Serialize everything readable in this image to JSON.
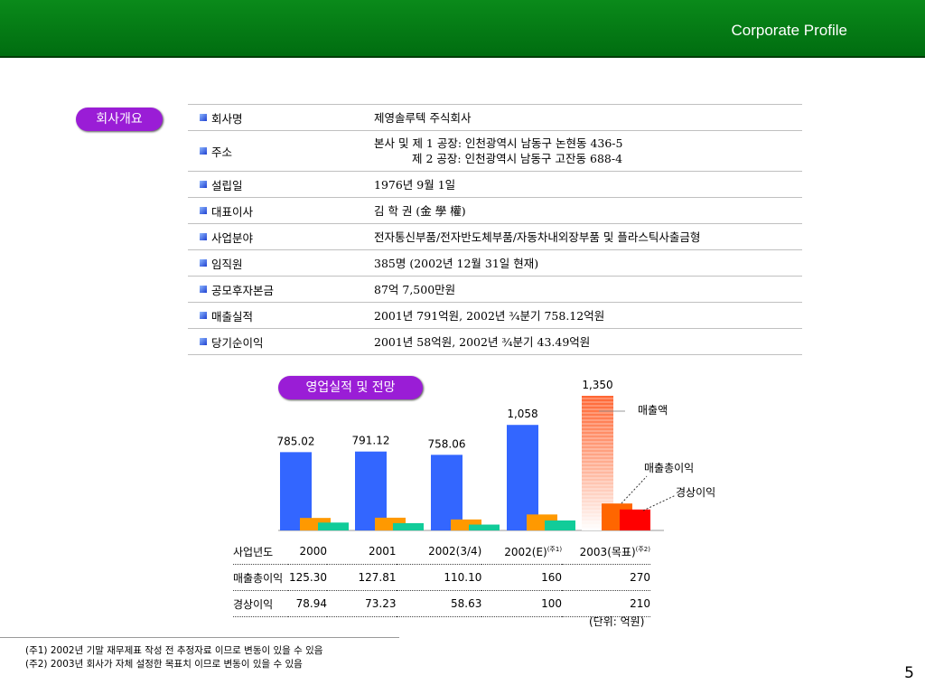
{
  "header": {
    "title": "Corporate Profile"
  },
  "section_profile": {
    "label": "회사개요"
  },
  "section_perf": {
    "label": "영업실적 및 전망"
  },
  "profile": [
    {
      "label": "회사명",
      "lines": [
        "제영솔루텍 주식회사"
      ]
    },
    {
      "label": "주소",
      "lines": [
        "본사 및 제 1 공장:   인천광역시 남동구 논현동 436-5",
        "제 2 공장:   인천광역시 남동구 고잔동 688-4"
      ]
    },
    {
      "label": "설립일",
      "lines": [
        "1976년 9월 1일"
      ]
    },
    {
      "label": "대표이사",
      "lines": [
        "김 학 권 (金 學 權)"
      ]
    },
    {
      "label": "사업분야",
      "lines": [
        "전자통신부품/전자반도체부품/자동차내외장부품 및 플라스틱사출금형"
      ]
    },
    {
      "label": "임직원",
      "lines": [
        "385명 (2002년 12월 31일 현재)"
      ]
    },
    {
      "label": "공모후자본금",
      "lines": [
        "87억 7,500만원"
      ]
    },
    {
      "label": "매출실적",
      "lines": [
        "2001년 791억원,  2002년 ¾분기 758.12억원"
      ]
    },
    {
      "label": "당기순이익",
      "lines": [
        "2001년   58억원,  2002년 ¾분기   43.49억원"
      ]
    }
  ],
  "chart_data": {
    "type": "bar",
    "categories": [
      "2000",
      "2001",
      "2002(3/4)",
      "2002(E)",
      "2003(목표)"
    ],
    "category_notes": [
      "",
      "",
      "",
      "(주1)",
      "(주2)"
    ],
    "series": [
      {
        "name": "매출액",
        "values": [
          785.02,
          791.12,
          758.06,
          1058,
          1350
        ],
        "labels": [
          "785.02",
          "791.12",
          "758.06",
          "1,058",
          "1,350"
        ]
      },
      {
        "name": "매출총이익",
        "values": [
          125.3,
          127.81,
          110.1,
          160,
          270
        ],
        "labels": [
          "125.30",
          "127.81",
          "110.10",
          "160",
          "270"
        ]
      },
      {
        "name": "경상이익",
        "values": [
          78.94,
          73.23,
          58.63,
          100,
          210
        ],
        "labels": [
          "78.94",
          "73.23",
          "58.63",
          "100",
          "210"
        ]
      }
    ],
    "colors": {
      "sales": "#3366ff",
      "gross": "#ff9900",
      "ordinary": "#11cc99",
      "target_sales": "#ff6633",
      "target_gross": "#ff6600",
      "target_ordinary": "#ff0000"
    },
    "ylim": [
      0,
      1400
    ]
  },
  "table": {
    "row_labels": [
      "사업년도",
      "매출총이익",
      "경상이익"
    ]
  },
  "unit_note": "(단위: 억원)",
  "footnotes": [
    "(주1) 2002년 기말 재무제표 작성 전 추정자료 이므로 변동이 있을 수 있음",
    "(주2) 2003년 회사가 자체 설정한 목표치 이므로 변동이 있을 수 있음"
  ],
  "page_number": "5"
}
